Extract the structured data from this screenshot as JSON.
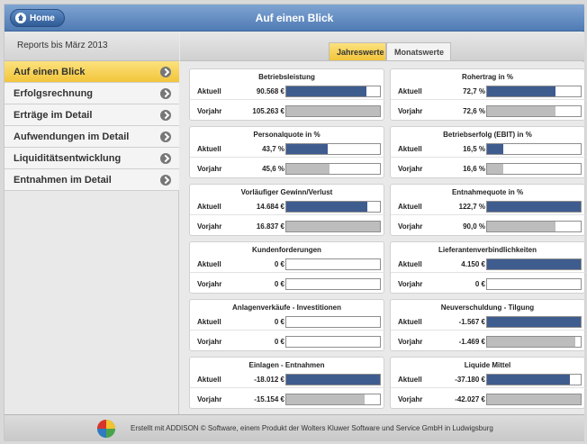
{
  "header": {
    "home_label": "Home",
    "title": "Auf einen Blick"
  },
  "sidebar": {
    "heading": "Reports bis März 2013",
    "items": [
      {
        "label": "Auf einen Blick",
        "active": true
      },
      {
        "label": "Erfolgsrechnung",
        "active": false
      },
      {
        "label": "Erträge im Detail",
        "active": false
      },
      {
        "label": "Aufwendungen im Detail",
        "active": false
      },
      {
        "label": "Liquiditätsentwicklung",
        "active": false
      },
      {
        "label": "Entnahmen im Detail",
        "active": false
      }
    ]
  },
  "tabs": {
    "active": "Jahreswerte",
    "inactive": "Monatswerte"
  },
  "labels": {
    "current": "Aktuell",
    "previous": "Vorjahr"
  },
  "cards": [
    {
      "title": "Betriebsleistung",
      "current": "90.568 €",
      "previous": "105.263 €",
      "current_fill": 0.86,
      "previous_fill": 1.0
    },
    {
      "title": "Rohertrag in %",
      "current": "72,7 %",
      "previous": "72,6 %",
      "current_fill": 0.73,
      "previous_fill": 0.73
    },
    {
      "title": "Personalquote in %",
      "current": "43,7 %",
      "previous": "45,6 %",
      "current_fill": 0.44,
      "previous_fill": 0.46
    },
    {
      "title": "Betriebserfolg (EBIT) in %",
      "current": "16,5 %",
      "previous": "16,6 %",
      "current_fill": 0.17,
      "previous_fill": 0.17
    },
    {
      "title": "Vorläufiger Gewinn/Verlust",
      "current": "14.684 €",
      "previous": "16.837 €",
      "current_fill": 0.87,
      "previous_fill": 1.0
    },
    {
      "title": "Entnahmequote in %",
      "current": "122,7 %",
      "previous": "90,0 %",
      "current_fill": 1.0,
      "previous_fill": 0.73
    },
    {
      "title": "Kundenforderungen",
      "current": "0 €",
      "previous": "0 €",
      "current_fill": 0.0,
      "previous_fill": 0.0
    },
    {
      "title": "Lieferantenverbindlichkeiten",
      "current": "4.150 €",
      "previous": "0 €",
      "current_fill": 1.0,
      "previous_fill": 0.0
    },
    {
      "title": "Anlagenverkäufe - Investitionen",
      "current": "0 €",
      "previous": "0 €",
      "current_fill": 0.0,
      "previous_fill": 0.0
    },
    {
      "title": "Neuverschuldung - Tilgung",
      "current": "-1.567 €",
      "previous": "-1.469 €",
      "current_fill": 1.0,
      "previous_fill": 0.94
    },
    {
      "title": "Einlagen - Entnahmen",
      "current": "-18.012 €",
      "previous": "-15.154 €",
      "current_fill": 1.0,
      "previous_fill": 0.84
    },
    {
      "title": "Liquide Mittel",
      "current": "-37.180 €",
      "previous": "-42.027 €",
      "current_fill": 0.88,
      "previous_fill": 1.0
    }
  ],
  "colors": {
    "current_bar": "#3f5c8f",
    "previous_bar": "#bdbdbd",
    "accent": "#f3c53a",
    "header": "#4f7bb4"
  },
  "footer": {
    "text": "Erstellt mit ADDISON © Software, einem Produkt der Wolters Kluwer Software und Service GmbH in Ludwigsburg"
  }
}
